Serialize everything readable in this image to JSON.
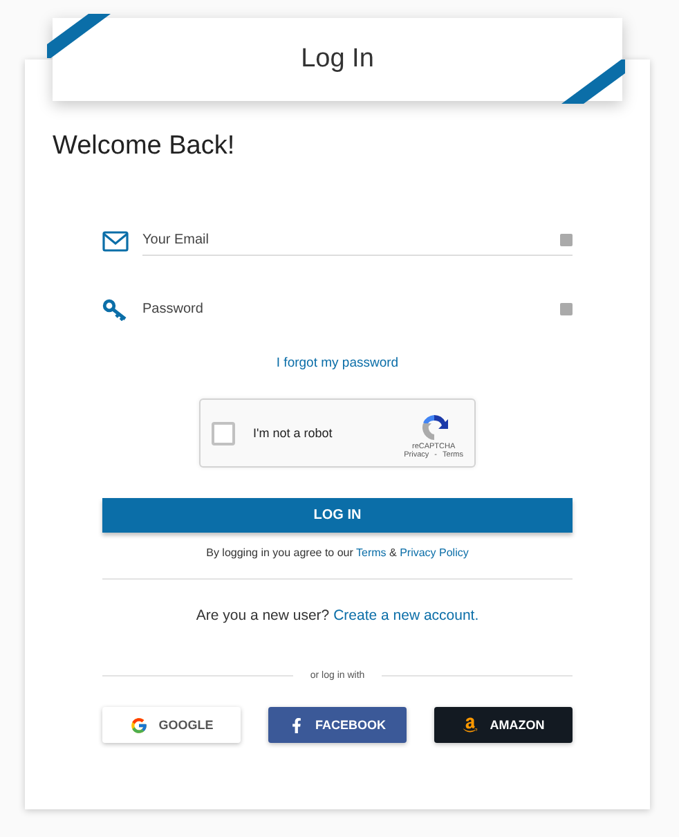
{
  "header": {
    "title": "Log In"
  },
  "heading": "Welcome Back!",
  "fields": [
    {
      "kind": "email",
      "placeholder": "Your Email"
    },
    {
      "kind": "password",
      "placeholder": "Password"
    }
  ],
  "forgot_link": "I forgot my password",
  "captcha": {
    "label": "I'm not a robot",
    "checked": false,
    "brand": "reCAPTCHA",
    "privacy": "Privacy",
    "separator": "-",
    "terms": "Terms"
  },
  "login_button": "LOG IN",
  "agreement": "By logging in you agree to our ",
  "agreement_terms": "Terms",
  "agreement_and": " & ",
  "agreement_privacy": "Privacy Policy",
  "signup_prompt": "Are you a new user? ",
  "signup_link": "Create a new account.",
  "divider_text": "or log in with",
  "social_buttons": [
    {
      "kind": "google",
      "label": "GOOGLE"
    },
    {
      "kind": "facebook",
      "label": "FACEBOOK"
    },
    {
      "kind": "amazon",
      "label": "AMAZON"
    }
  ]
}
